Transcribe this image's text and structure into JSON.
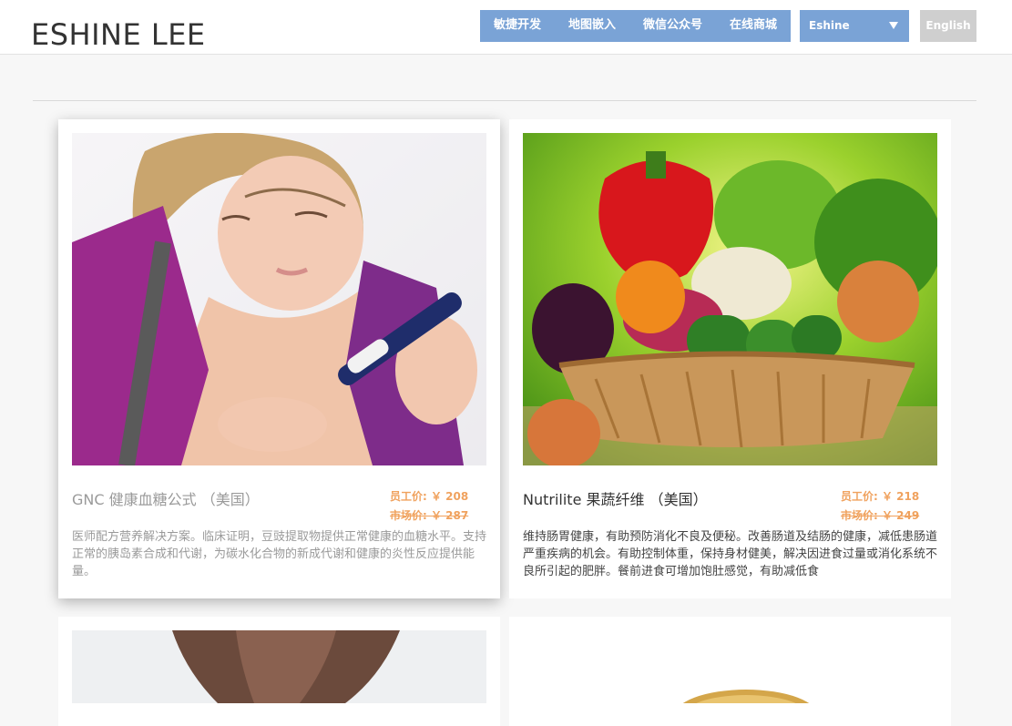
{
  "header": {
    "brand": "ESHINE LEE",
    "nav": [
      "敏捷开发",
      "地图嵌入",
      "微信公众号",
      "在线商城"
    ],
    "account_select": "Eshine",
    "language_button": "English"
  },
  "colors": {
    "nav_bg": "#7aa3d6",
    "price_accent": "#f0a25e",
    "language_button_bg": "#cfcfcf"
  },
  "products": [
    {
      "title": "GNC 健康血糖公式 （美国）",
      "staff_price": "员工价: ￥ 208",
      "market_price": "市场价: ￥ 287",
      "description": "医师配方营养解决方案。临床证明，豆豉提取物提供正常健康的血糖水平。支持正常的胰岛素合成和代谢，为碳水化合物的新成代谢和健康的炎性反应提供能量。",
      "image": "woman-testing-blood-sugar-photo"
    },
    {
      "title": "Nutrilite 果蔬纤维 （美国）",
      "staff_price": "员工价: ￥ 218",
      "market_price": "市场价: ￥ 249",
      "description": "维持肠胃健康，有助预防消化不良及便秘。改善肠道及结肠的健康，减低患肠道严重疾病的机会。有助控制体重，保持身材健美，解决因进食过量或消化系统不良所引起的肥胖。餐前进食可增加饱肚感觉，有助减低食",
      "image": "vegetable-basket-photo"
    },
    {
      "image": "fitness-torso-photo"
    },
    {
      "image": "supplement-jar-photo"
    }
  ]
}
